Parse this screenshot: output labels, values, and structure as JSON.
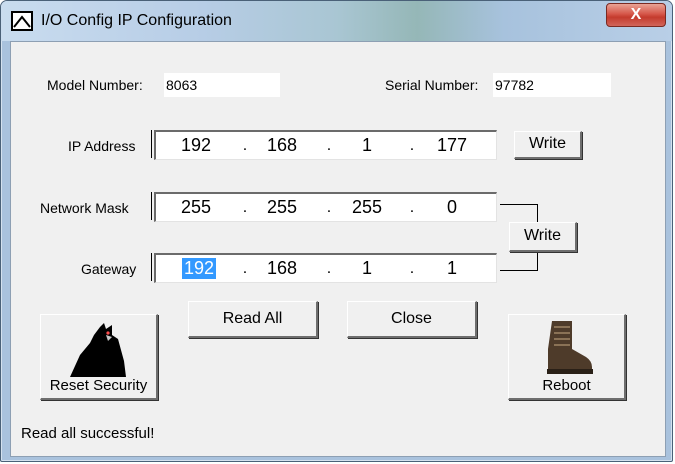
{
  "window": {
    "title": "I/O Config IP Configuration",
    "close_glyph": "X"
  },
  "model": {
    "label": "Model Number:",
    "value": "8063"
  },
  "serial": {
    "label": "Serial Number:",
    "value": "97782"
  },
  "ip": {
    "label": "IP Address",
    "octets": [
      "192",
      "168",
      "1",
      "177"
    ],
    "write_label": "Write"
  },
  "mask": {
    "label": "Network Mask",
    "octets": [
      "255",
      "255",
      "255",
      "0"
    ]
  },
  "gateway": {
    "label": "Gateway",
    "octets": [
      "192",
      "168",
      "1",
      "1"
    ],
    "selected_octet": "192"
  },
  "net_write_label": "Write",
  "buttons": {
    "read_all": "Read All",
    "close": "Close",
    "reset_security": "Reset Security",
    "reboot": "Reboot"
  },
  "icons": {
    "reset_security": "cat-icon",
    "reboot": "boot-icon",
    "title": "window-icon"
  },
  "status": "Read all successful!",
  "colors": {
    "selection": "#3399ff",
    "close_button": "#c43b2d",
    "dialog_bg": "#f0f0f0"
  }
}
